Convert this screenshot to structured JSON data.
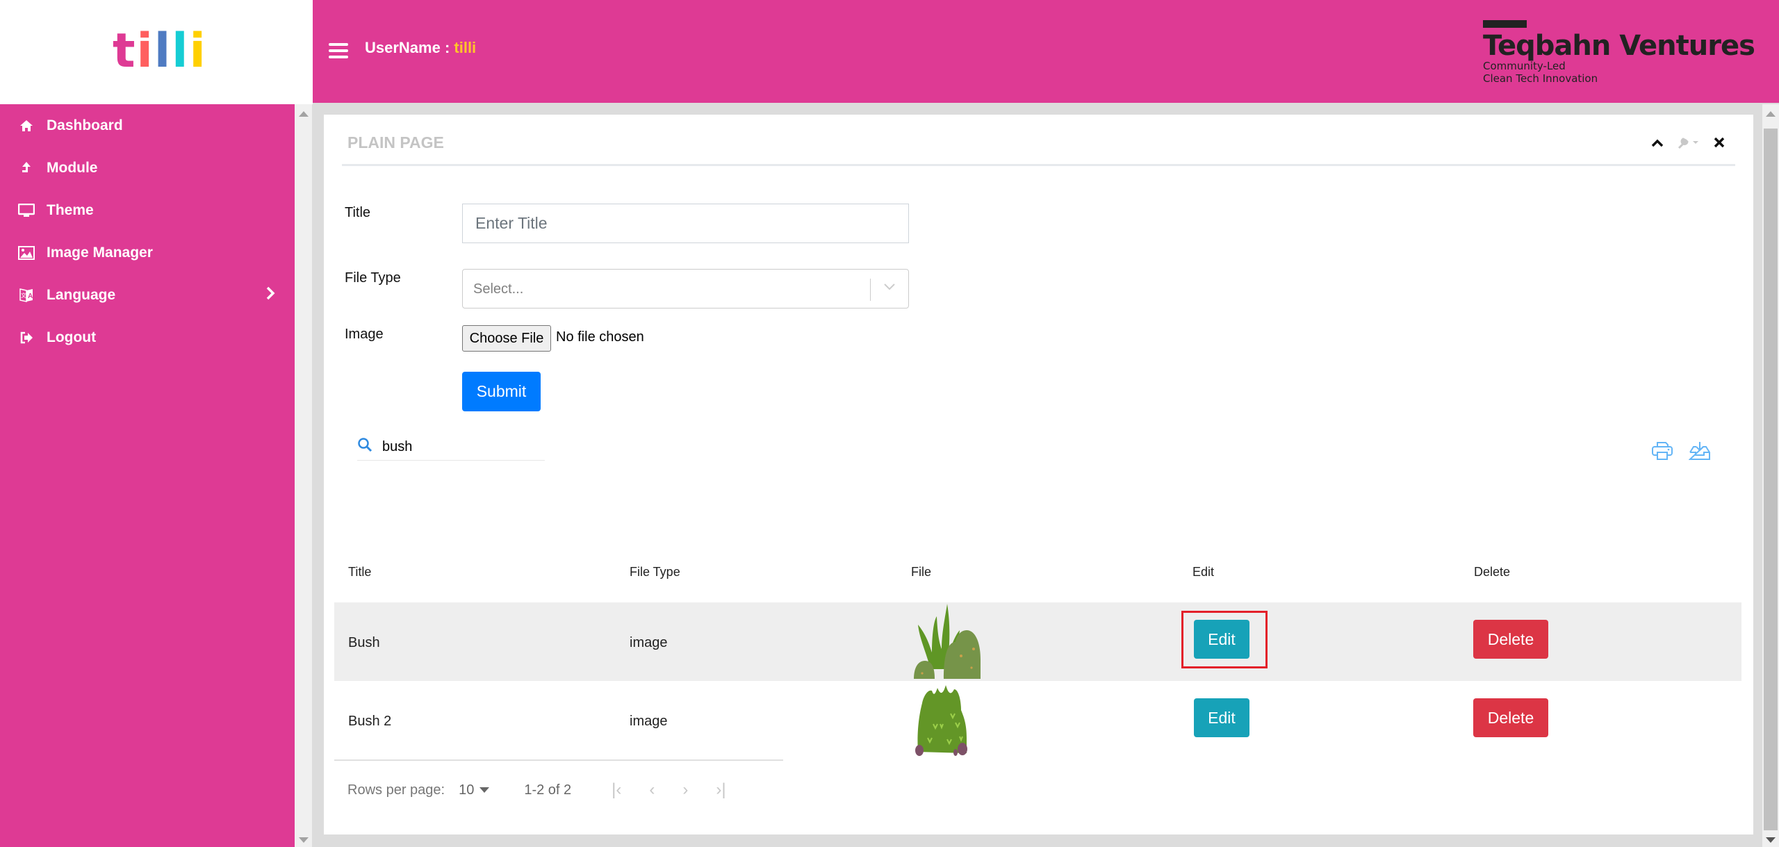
{
  "logo": {
    "letters": [
      "t",
      "i",
      "l",
      "l",
      "i"
    ],
    "colors": [
      "#de3a94",
      "#ff5f5f",
      "#4f7bc2",
      "#16cdd4",
      "#ffd000"
    ]
  },
  "sidebar": {
    "items": [
      {
        "label": "Dashboard",
        "icon": "home-icon"
      },
      {
        "label": "Module",
        "icon": "upload-arrow-icon"
      },
      {
        "label": "Theme",
        "icon": "monitor-icon"
      },
      {
        "label": "Image Manager",
        "icon": "image-icon"
      },
      {
        "label": "Language",
        "icon": "translate-icon",
        "has_submenu": true
      },
      {
        "label": "Logout",
        "icon": "logout-icon"
      }
    ]
  },
  "header": {
    "username_label": "UserName : ",
    "username_value": "tilli",
    "brand_name": "Teqbahn Ventures",
    "brand_tag1": "Community-Led",
    "brand_tag2": "Clean Tech Innovation"
  },
  "panel": {
    "title": "PLAIN PAGE",
    "form": {
      "title_label": "Title",
      "title_placeholder": "Enter Title",
      "title_value": "",
      "filetype_label": "File Type",
      "filetype_placeholder": "Select...",
      "image_label": "Image",
      "choose_file_label": "Choose File",
      "file_status": "No file chosen",
      "submit_label": "Submit"
    },
    "search": {
      "value": "bush"
    },
    "table": {
      "columns": [
        "Title",
        "File Type",
        "File",
        "Edit",
        "Delete"
      ],
      "rows": [
        {
          "title": "Bush",
          "file_type": "image",
          "file": "bush-thumbnail",
          "edit_label": "Edit",
          "delete_label": "Delete",
          "highlighted": true
        },
        {
          "title": "Bush 2",
          "file_type": "image",
          "file": "bush2-thumbnail",
          "edit_label": "Edit",
          "delete_label": "Delete",
          "highlighted": false
        }
      ]
    },
    "pagination": {
      "rows_per_page_label": "Rows per page:",
      "rows_per_page_value": "10",
      "range": "1-2 of 2"
    }
  },
  "colors": {
    "brand_pink": "#de3a94",
    "username_accent": "#ffc629",
    "submit_blue": "#007bff",
    "edit_teal": "#17a2b8",
    "delete_red": "#dc3545"
  }
}
